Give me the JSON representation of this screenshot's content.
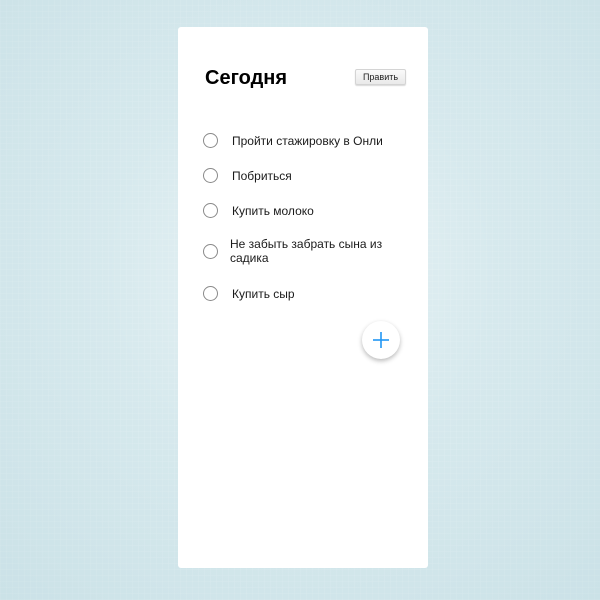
{
  "header": {
    "title": "Сегодня",
    "edit_label": "Править"
  },
  "tasks": [
    {
      "text": "Пройти стажировку в Онли",
      "done": false
    },
    {
      "text": "Побриться",
      "done": false
    },
    {
      "text": "Купить молоко",
      "done": false
    },
    {
      "text": "Не забыть забрать сына из садика",
      "done": false
    },
    {
      "text": "Купить сыр",
      "done": false
    }
  ],
  "add_button": {
    "icon": "plus-icon",
    "color": "#2196f3"
  },
  "colors": {
    "background": "#cfe5ea",
    "card": "#ffffff",
    "accent": "#2196f3"
  }
}
